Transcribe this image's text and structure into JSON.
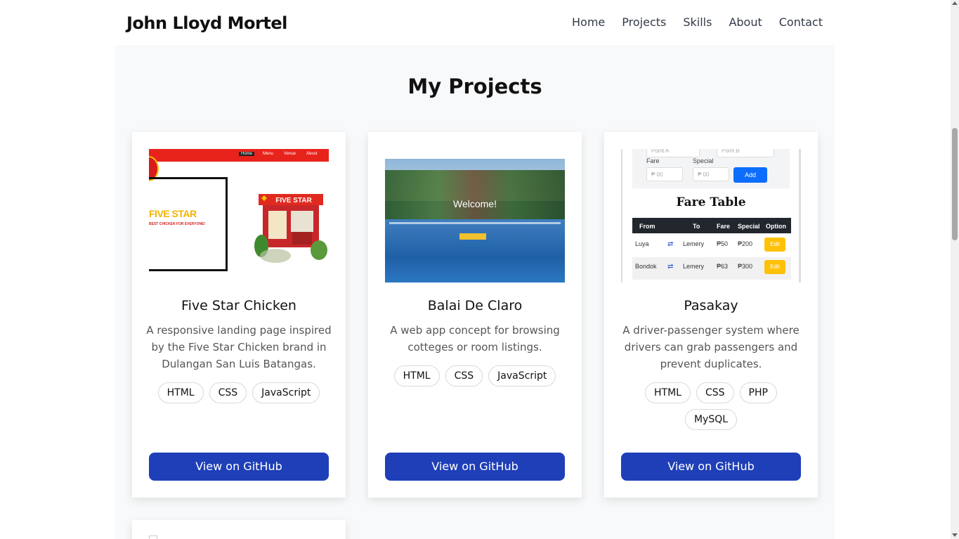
{
  "header": {
    "brand": "John Lloyd Mortel",
    "nav": [
      "Home",
      "Projects",
      "Skills",
      "About",
      "Contact"
    ]
  },
  "section": {
    "title": "My Projects"
  },
  "projects": [
    {
      "name": "Five Star Chicken",
      "description": "A responsive landing page inspired by the Five Star Chicken brand in Dulangan San Luis Batangas.",
      "tags": [
        "HTML",
        "CSS",
        "JavaScript"
      ],
      "button": "View on GitHub",
      "thumb": {
        "nav": [
          "Home",
          "Menu",
          "Venue",
          "About"
        ],
        "title": "FIVE STAR",
        "subtitle": "BEST CHICKEN FOR EVERYONE!",
        "shop_sign": "FIVE STAR"
      }
    },
    {
      "name": "Balai De Claro",
      "description": "A web app concept for browsing cotteges or room listings.",
      "tags": [
        "HTML",
        "CSS",
        "JavaScript"
      ],
      "button": "View on GitHub",
      "thumb": {
        "welcome": "Welcome!"
      }
    },
    {
      "name": "Pasakay",
      "description": "A driver-passenger system where drivers can grab passengers and prevent duplicates.",
      "tags": [
        "HTML",
        "CSS",
        "PHP",
        "MySQL"
      ],
      "button": "View on GitHub",
      "thumb": {
        "form": {
          "point_a": "Point A",
          "point_b": "Point B",
          "fare_label": "Fare",
          "special_label": "Special",
          "fare_placeholder": "₱ 00",
          "special_placeholder": "₱ 00",
          "add": "Add"
        },
        "table_title": "Fare Table",
        "columns": [
          "From",
          "To",
          "Fare",
          "Special",
          "Option"
        ],
        "rows": [
          {
            "from": "Luya",
            "to": "Lemery",
            "fare": "₱50",
            "special": "₱200",
            "option": "Edit"
          },
          {
            "from": "Bondok",
            "to": "Lemery",
            "fare": "₱63",
            "special": "₱300",
            "option": "Edit"
          }
        ]
      }
    }
  ],
  "colors": {
    "accent": "#1e3fb8",
    "section_bg": "#f8f9fa"
  }
}
